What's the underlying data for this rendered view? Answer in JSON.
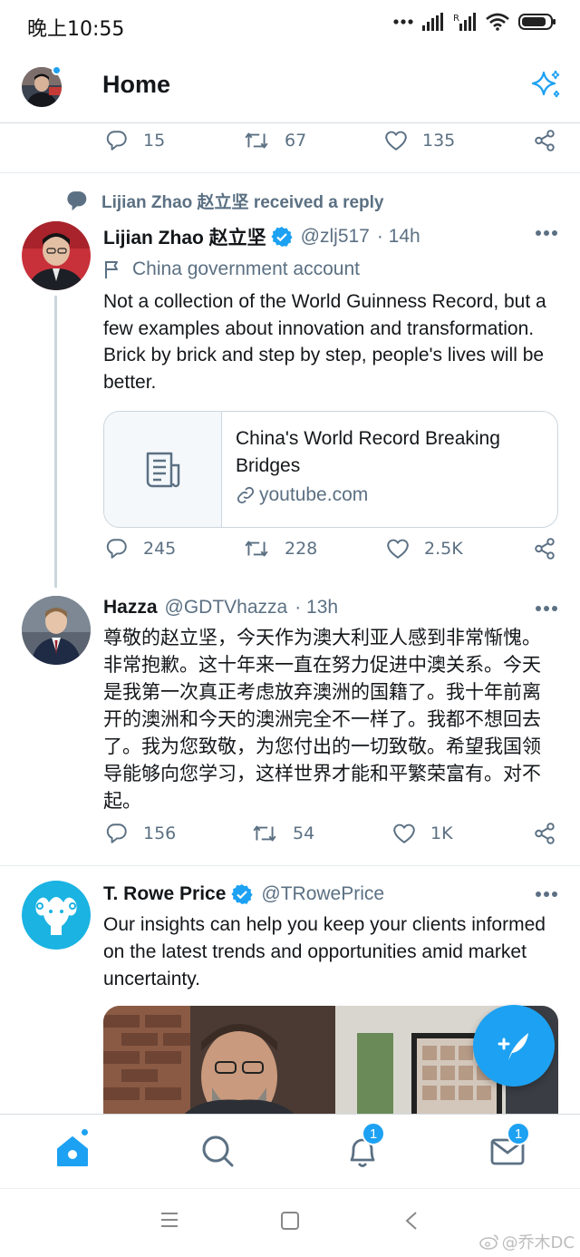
{
  "status_bar": {
    "time": "晚上10:55",
    "battery_level": 0.85
  },
  "header": {
    "title": "Home"
  },
  "top_tweet_actions": {
    "replies": "15",
    "retweets": "67",
    "likes": "135"
  },
  "tweet_zhao": {
    "context": "Lijian Zhao 赵立坚 received a reply",
    "name": "Lijian Zhao 赵立坚",
    "handle": "@zlj517",
    "time": "· 14h",
    "label": "China government account",
    "text": "Not a collection of the World Guinness Record, but a few examples about innovation and transformation. Brick by brick and step by step, people's lives will be better.",
    "card": {
      "title": "China's World Record Breaking Bridges",
      "domain": "youtube.com"
    },
    "replies": "245",
    "retweets": "228",
    "likes": "2.5K"
  },
  "tweet_hazza": {
    "name": "Hazza",
    "handle": "@GDTVhazza",
    "time": "· 13h",
    "text": "尊敬的赵立坚，今天作为澳大利亚人感到非常惭愧。非常抱歉。这十年来一直在努力促进中澳关系。今天是我第一次真正考虑放弃澳洲的国籍了。我十年前离开的澳洲和今天的澳洲完全不一样了。我都不想回去了。我为您致敬，为您付出的一切致敬。希望我国领导能够向您学习，这样世界才能和平繁荣富有。对不起。",
    "replies": "156",
    "retweets": "54",
    "likes": "1K"
  },
  "tweet_trowe": {
    "name": "T. Rowe Price",
    "handle": "@TRowePrice",
    "text": "Our insights can help you keep your clients informed on the latest trends and opportunities amid market uncertainty."
  },
  "bottom_nav": {
    "notifications_badge": "1",
    "messages_badge": "1"
  },
  "watermark": "@乔木DC",
  "colors": {
    "accent": "#1da1f2",
    "secondary_text": "#5b7083",
    "divider": "#e6ecf0"
  },
  "icons": [
    "reply-icon",
    "retweet-icon",
    "like-icon",
    "share-icon",
    "more-icon",
    "verified-icon",
    "sparkle-icon",
    "home-icon",
    "search-icon",
    "bell-icon",
    "mail-icon",
    "compose-icon"
  ]
}
